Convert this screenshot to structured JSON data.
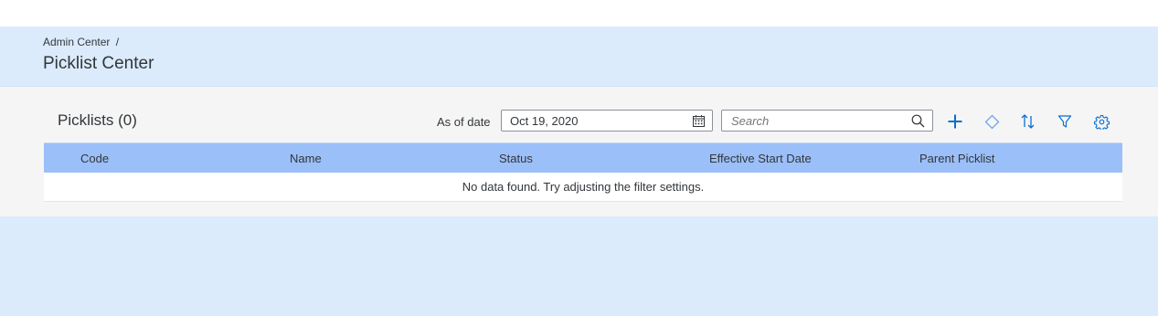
{
  "header": {
    "breadcrumb": "Admin Center",
    "breadcrumb_separator": "/",
    "title": "Picklist Center"
  },
  "toolbar": {
    "table_title": "Picklists (0)",
    "as_of_label": "As of date",
    "as_of_value": "Oct 19, 2020",
    "search_placeholder": "Search",
    "icons": [
      "calendar-icon",
      "search-icon",
      "add-icon",
      "diamond-icon",
      "sort-icon",
      "filter-icon",
      "settings-icon"
    ]
  },
  "table": {
    "columns": [
      "Code",
      "Name",
      "Status",
      "Effective Start Date",
      "Parent Picklist"
    ],
    "no_data_text": "No data found. Try adjusting the filter settings."
  },
  "colors": {
    "header_bg": "#dcebfb",
    "content_bg": "#f5f5f5",
    "table_header_bg": "#9bbff8",
    "accent": "#0a6ed1"
  }
}
